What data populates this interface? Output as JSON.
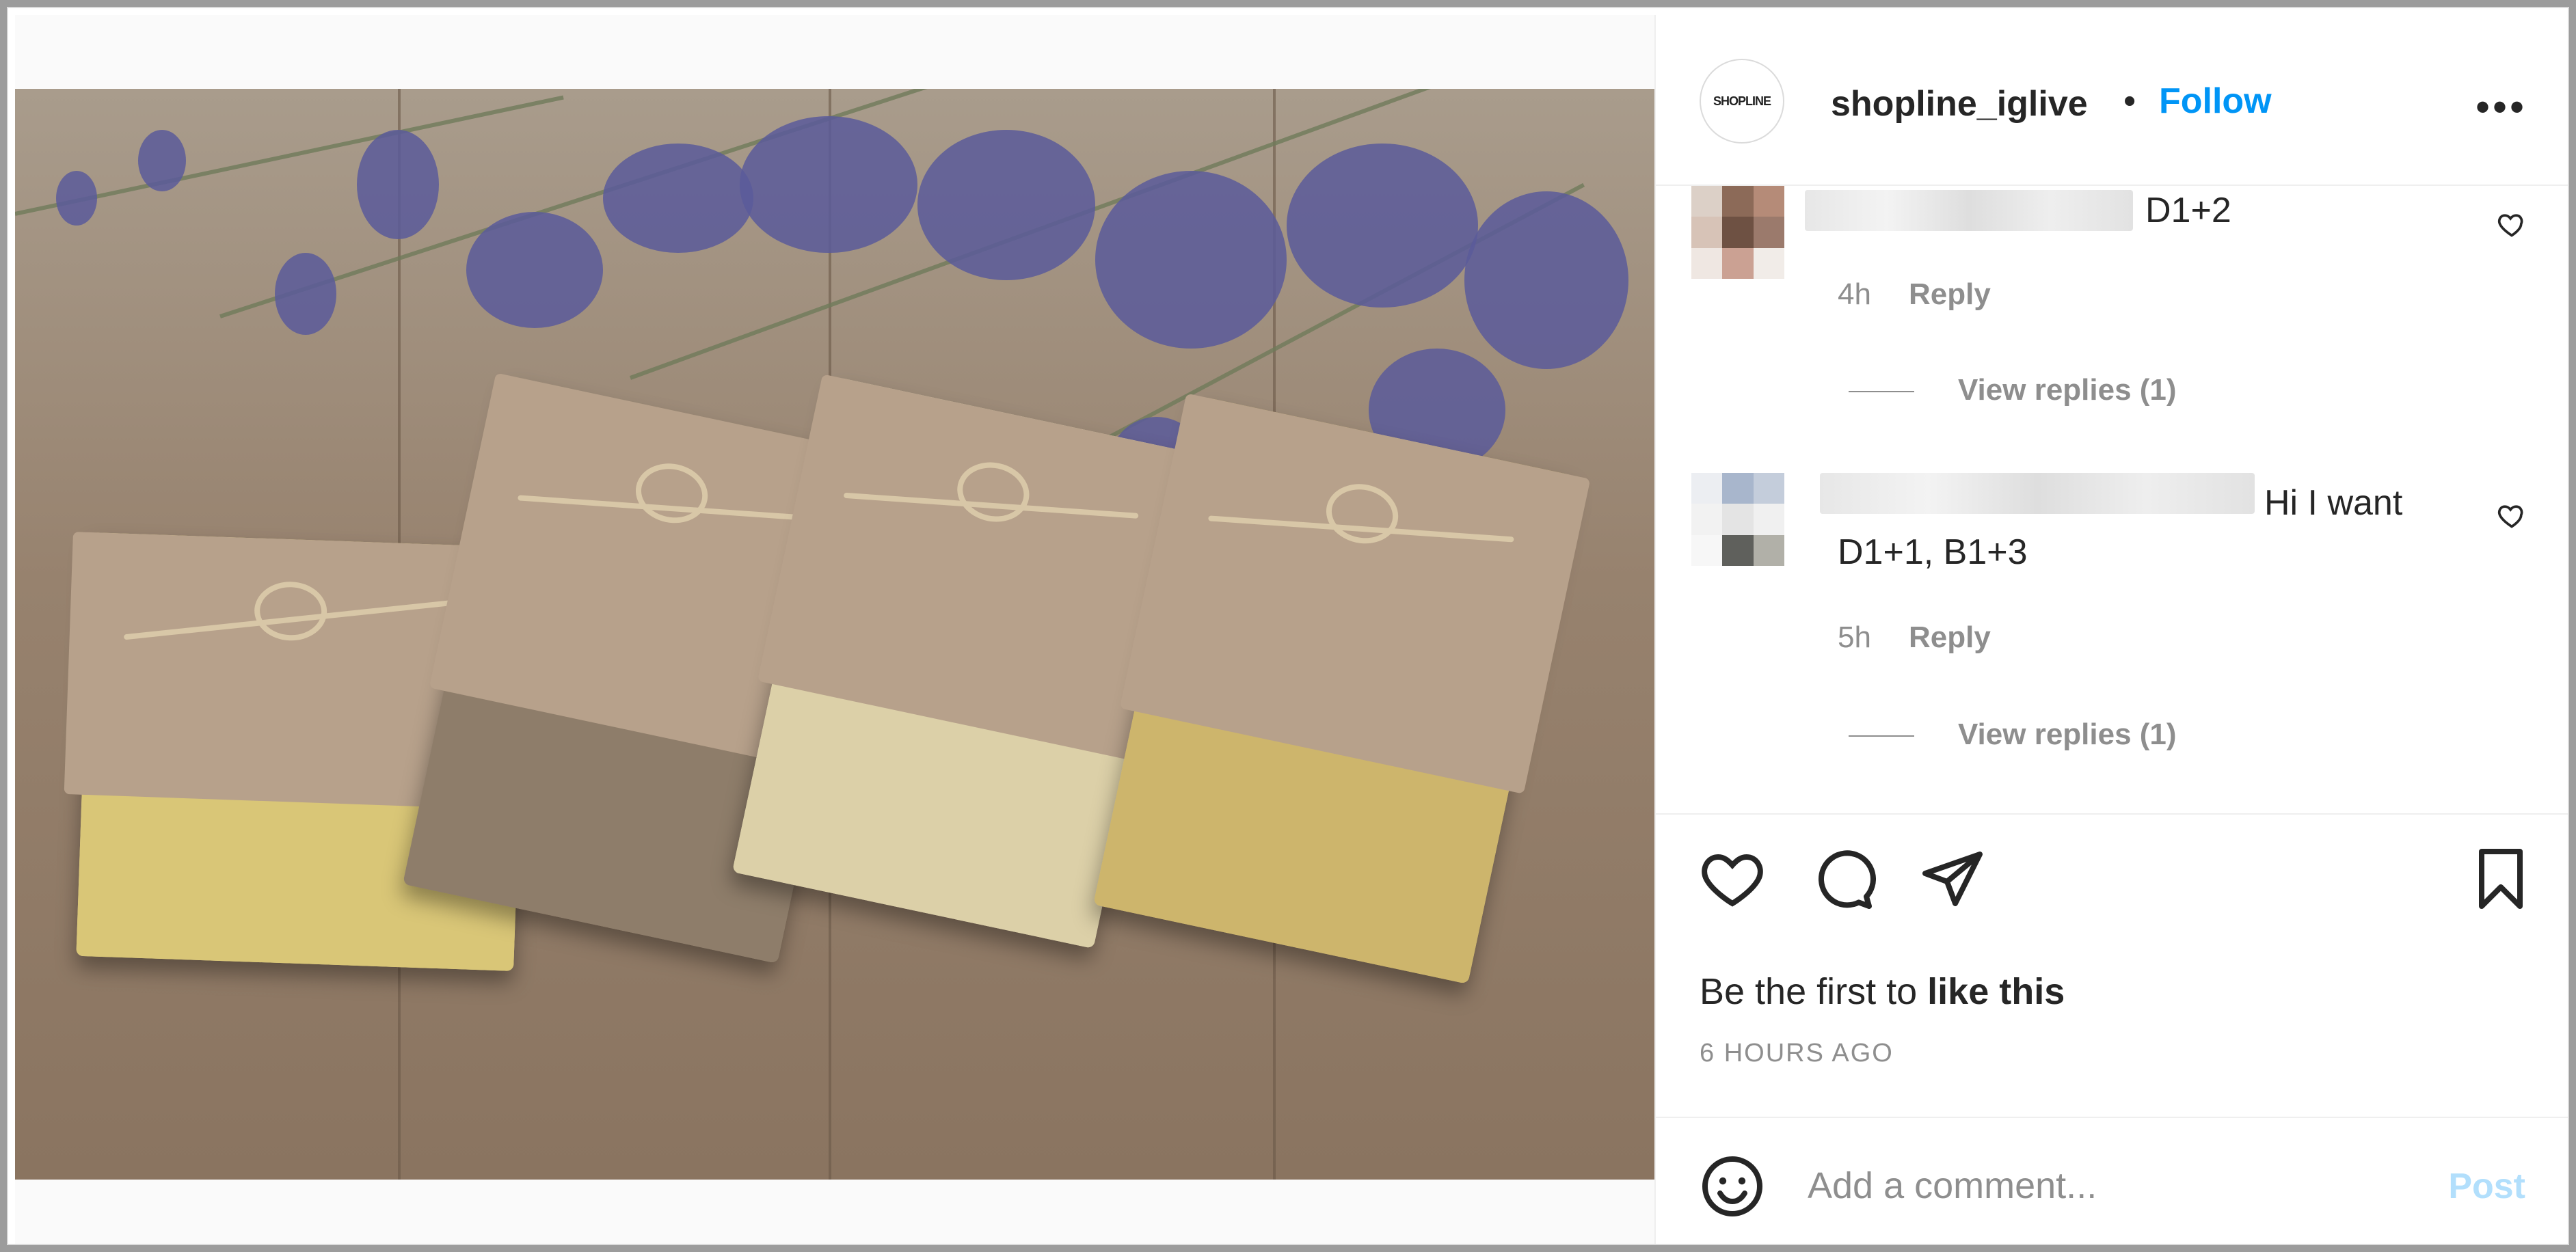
{
  "post": {
    "image_alt": "Handmade soaps with lavender",
    "header": {
      "avatar_text": "SHOPLINE",
      "username": "shopline_iglive",
      "separator": "•",
      "follow_label": "Follow",
      "more_icon": "ellipsis-icon"
    },
    "comments": [
      {
        "text": "D1+2",
        "time": "4h",
        "reply_label": "Reply",
        "view_replies": "View replies (1)",
        "like_icon": "heart-outline-icon"
      },
      {
        "text_line1": "Hi I want",
        "text_line2": "D1+1, B1+3",
        "time": "5h",
        "reply_label": "Reply",
        "view_replies": "View replies (1)",
        "like_icon": "heart-outline-icon"
      }
    ],
    "actions": {
      "like_icon": "heart-icon",
      "comment_icon": "comment-bubble-icon",
      "share_icon": "paper-plane-icon",
      "save_icon": "bookmark-icon",
      "likes_prefix": "Be the first to ",
      "likes_bold": "like this",
      "timestamp": "6 HOURS AGO"
    },
    "add_comment": {
      "emoji_icon": "smiley-icon",
      "placeholder": "Add a comment...",
      "post_label": "Post"
    }
  }
}
